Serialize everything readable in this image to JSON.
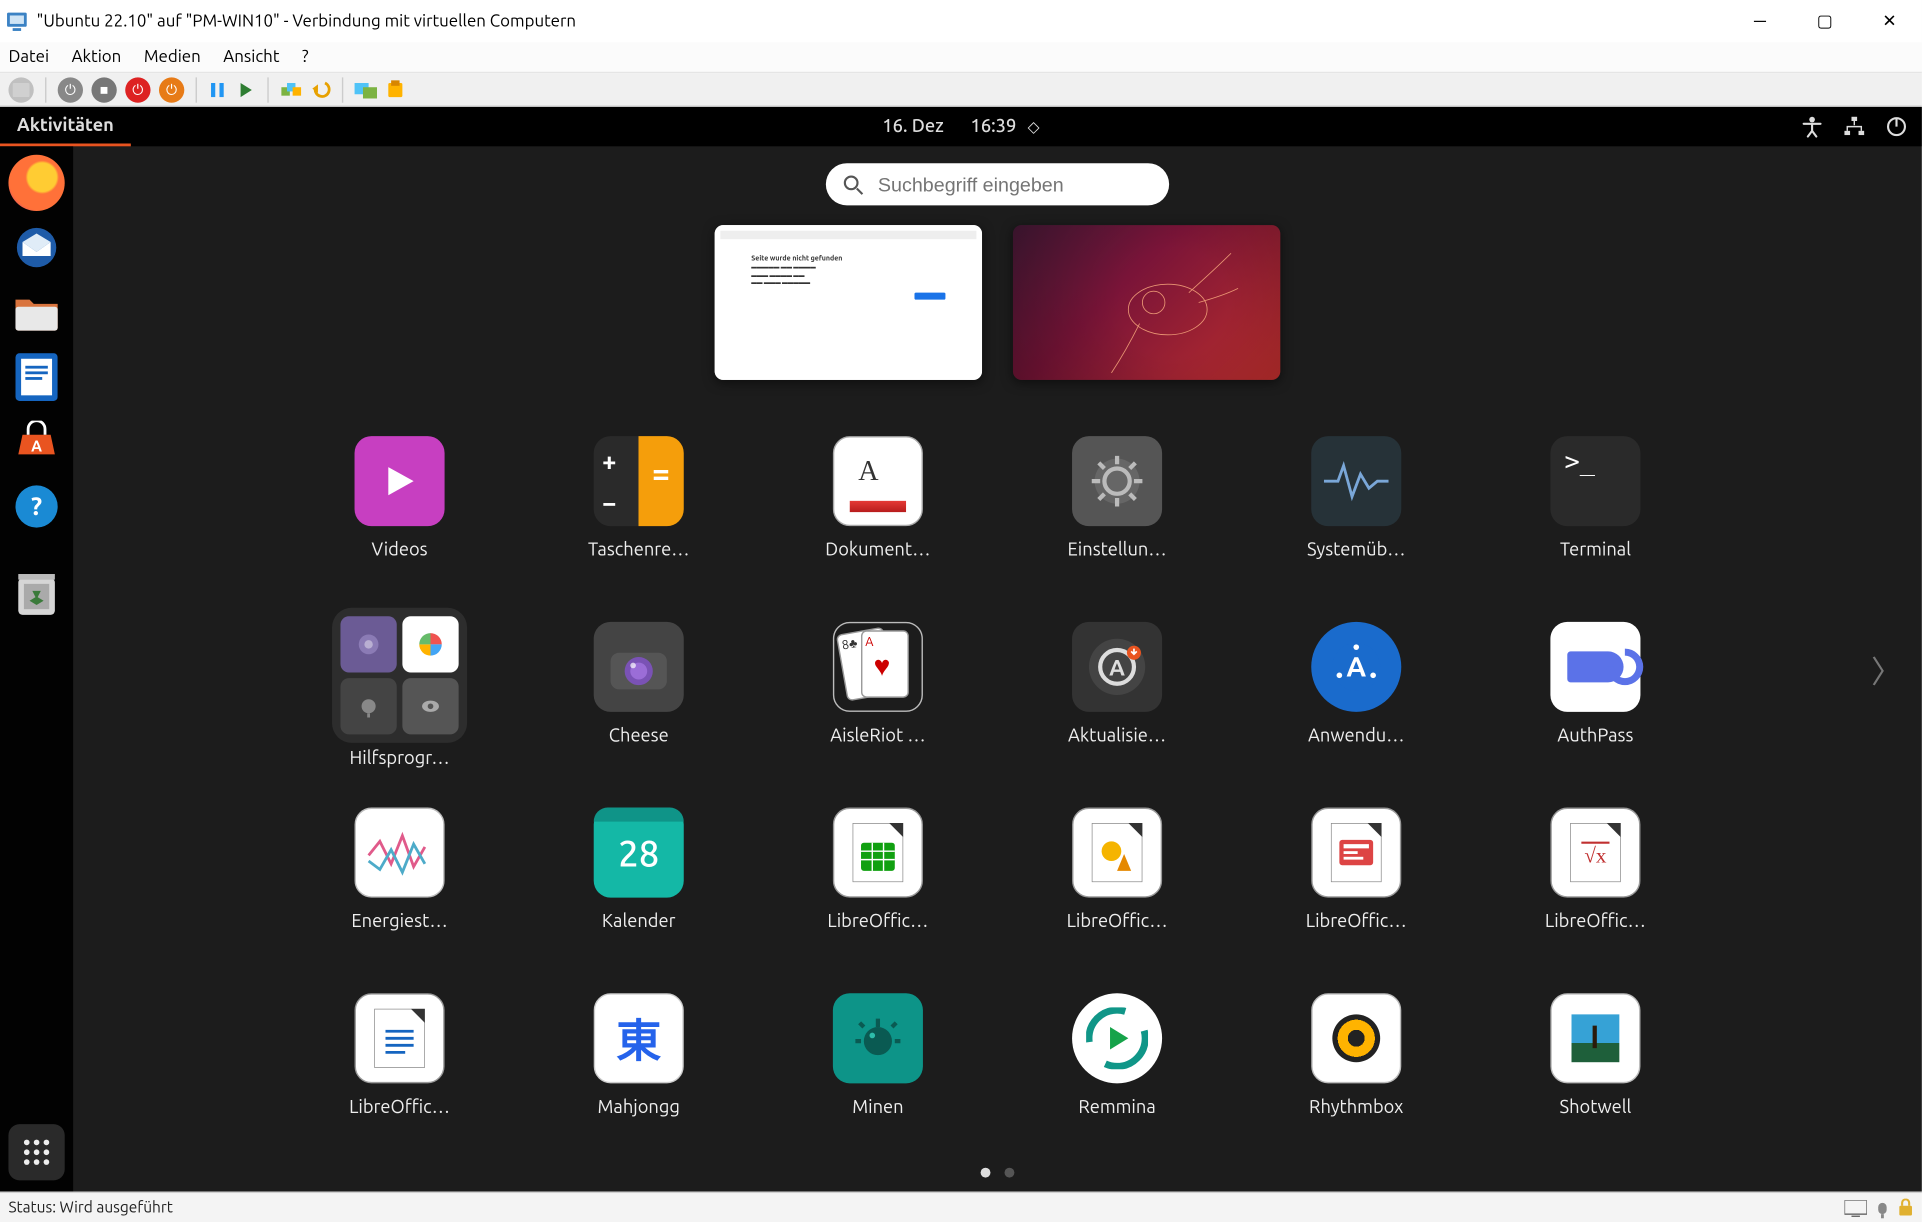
{
  "host_window": {
    "title": "\"Ubuntu 22.10\" auf \"PM-WIN10\" - Verbindung mit virtuellen Computern",
    "menu": [
      "Datei",
      "Aktion",
      "Medien",
      "Ansicht",
      "?"
    ],
    "status": "Status: Wird ausgeführt"
  },
  "topbar": {
    "activities": "Aktivitäten",
    "date": "16. Dez",
    "time": "16:39"
  },
  "search": {
    "placeholder": "Suchbegriff eingeben"
  },
  "apps": [
    {
      "id": "videos",
      "label": "Videos"
    },
    {
      "id": "calc",
      "label": "Taschenre…"
    },
    {
      "id": "docscan",
      "label": "Dokument…"
    },
    {
      "id": "settings",
      "label": "Einstellun…"
    },
    {
      "id": "sysmon",
      "label": "Systemüb…"
    },
    {
      "id": "terminal",
      "label": "Terminal"
    },
    {
      "id": "utilities",
      "label": "Hilfsprogr…",
      "folder": true
    },
    {
      "id": "cheese",
      "label": "Cheese"
    },
    {
      "id": "aisleriot",
      "label": "AisleRiot …"
    },
    {
      "id": "updater",
      "label": "Aktualisie…"
    },
    {
      "id": "software",
      "label": "Anwendu…"
    },
    {
      "id": "authpass",
      "label": "AuthPass"
    },
    {
      "id": "power",
      "label": "Energiest…"
    },
    {
      "id": "calendar",
      "label": "Kalender",
      "day": "28"
    },
    {
      "id": "localc",
      "label": "LibreOffic…"
    },
    {
      "id": "lodraw",
      "label": "LibreOffic…"
    },
    {
      "id": "loimpress",
      "label": "LibreOffic…"
    },
    {
      "id": "lomath",
      "label": "LibreOffic…"
    },
    {
      "id": "lowriter",
      "label": "LibreOffic…"
    },
    {
      "id": "mahjongg",
      "label": "Mahjongg",
      "glyph": "東"
    },
    {
      "id": "mines",
      "label": "Minen"
    },
    {
      "id": "remmina",
      "label": "Remmina"
    },
    {
      "id": "rhythmbox",
      "label": "Rhythmbox"
    },
    {
      "id": "shotwell",
      "label": "Shotwell"
    }
  ]
}
